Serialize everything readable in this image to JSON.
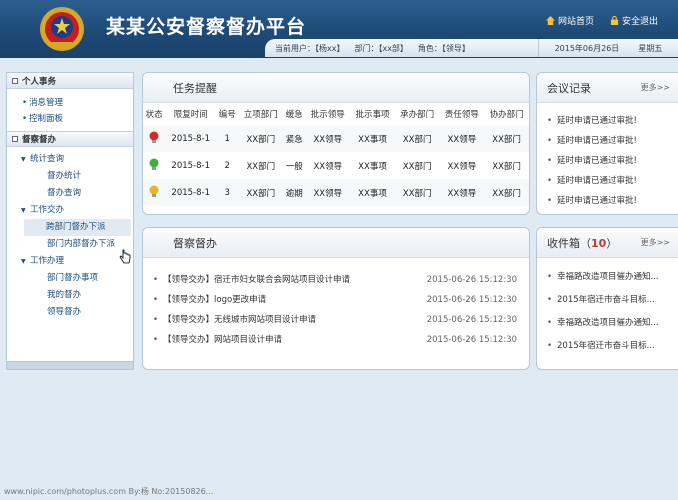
{
  "header": {
    "title": "某某公安督察督办平台",
    "links": {
      "home": "网站首页",
      "logout": "安全退出"
    },
    "user": {
      "user_label": "当前用户：【杨xx】",
      "dept_label": "部门：【xx部】",
      "role_label": "角色：【领导】"
    },
    "date": "2015年06月26日",
    "weekday": "星期五"
  },
  "sidebar": {
    "personal": {
      "title": "个人事务",
      "items": [
        "消息管理",
        "控制面板"
      ]
    },
    "supervise": {
      "title": "督察督办",
      "groups": [
        {
          "label": "统计查询",
          "items": [
            "督办统计",
            "督办查询"
          ]
        },
        {
          "label": "工作交办",
          "items": [
            "跨部门督办下派",
            "部门内部督办下派"
          ]
        },
        {
          "label": "工作办理",
          "items": [
            "部门督办事项",
            "我的督办",
            "领导督办"
          ]
        }
      ]
    }
  },
  "tasks": {
    "title": "任务提醒",
    "headers": [
      "状态",
      "限复时间",
      "编号",
      "立项部门",
      "缓急",
      "批示领导",
      "批示事项",
      "承办部门",
      "责任领导",
      "协办部门"
    ],
    "rows": [
      {
        "status": "red",
        "date": "2015-8-1",
        "no": "1",
        "dept": "XX部门",
        "urgency": "紧急",
        "leader": "XX领导",
        "matter": "XX事项",
        "handler": "XX部门",
        "resp": "XX领导",
        "assist": "XX部门"
      },
      {
        "status": "green",
        "date": "2015-8-1",
        "no": "2",
        "dept": "XX部门",
        "urgency": "一般",
        "leader": "XX领导",
        "matter": "XX事项",
        "handler": "XX部门",
        "resp": "XX领导",
        "assist": "XX部门"
      },
      {
        "status": "yellow",
        "date": "2015-8-1",
        "no": "3",
        "dept": "XX部门",
        "urgency": "逾期",
        "leader": "XX领导",
        "matter": "XX事项",
        "handler": "XX部门",
        "resp": "XX领导",
        "assist": "XX部门"
      }
    ]
  },
  "meetings": {
    "title": "会议记录",
    "more": "更多>>",
    "items": [
      "延时申请已通过审批!",
      "延时申请已通过审批!",
      "延时申请已通过审批!",
      "延时申请已通过审批!",
      "延时申请已通过审批!"
    ]
  },
  "supervision": {
    "title": "督察督办",
    "items": [
      {
        "text": "【领导交办】宿迁市妇女联合会网站项目设计申请",
        "date": "2015-06-26 15:12:30"
      },
      {
        "text": "【领导交办】logo更改申请",
        "date": "2015-06-26 15:12:30"
      },
      {
        "text": "【领导交办】无线城市网站项目设计申请",
        "date": "2015-06-26 15:12:30"
      },
      {
        "text": "【领导交办】网站项目设计申请",
        "date": "2015-06-26 15:12:30"
      }
    ]
  },
  "inbox": {
    "title": "收件箱（",
    "count": "10",
    "title_end": "）",
    "more": "更多>>",
    "items": [
      "幸福路改造项目催办通知...",
      "2015年宿迁市奋斗目标...",
      "幸福路改造项目催办通知...",
      "2015年宿迁市奋斗目标..."
    ]
  },
  "footer": {
    "watermark": "www.nipic.com/photoplus.com  By:杨 No:20150826..."
  },
  "colors": {
    "header_dark": "#1e4a76",
    "link_blue": "#1e4f84",
    "urgent_red": "#d31c1c",
    "count_red": "#c0392b"
  }
}
